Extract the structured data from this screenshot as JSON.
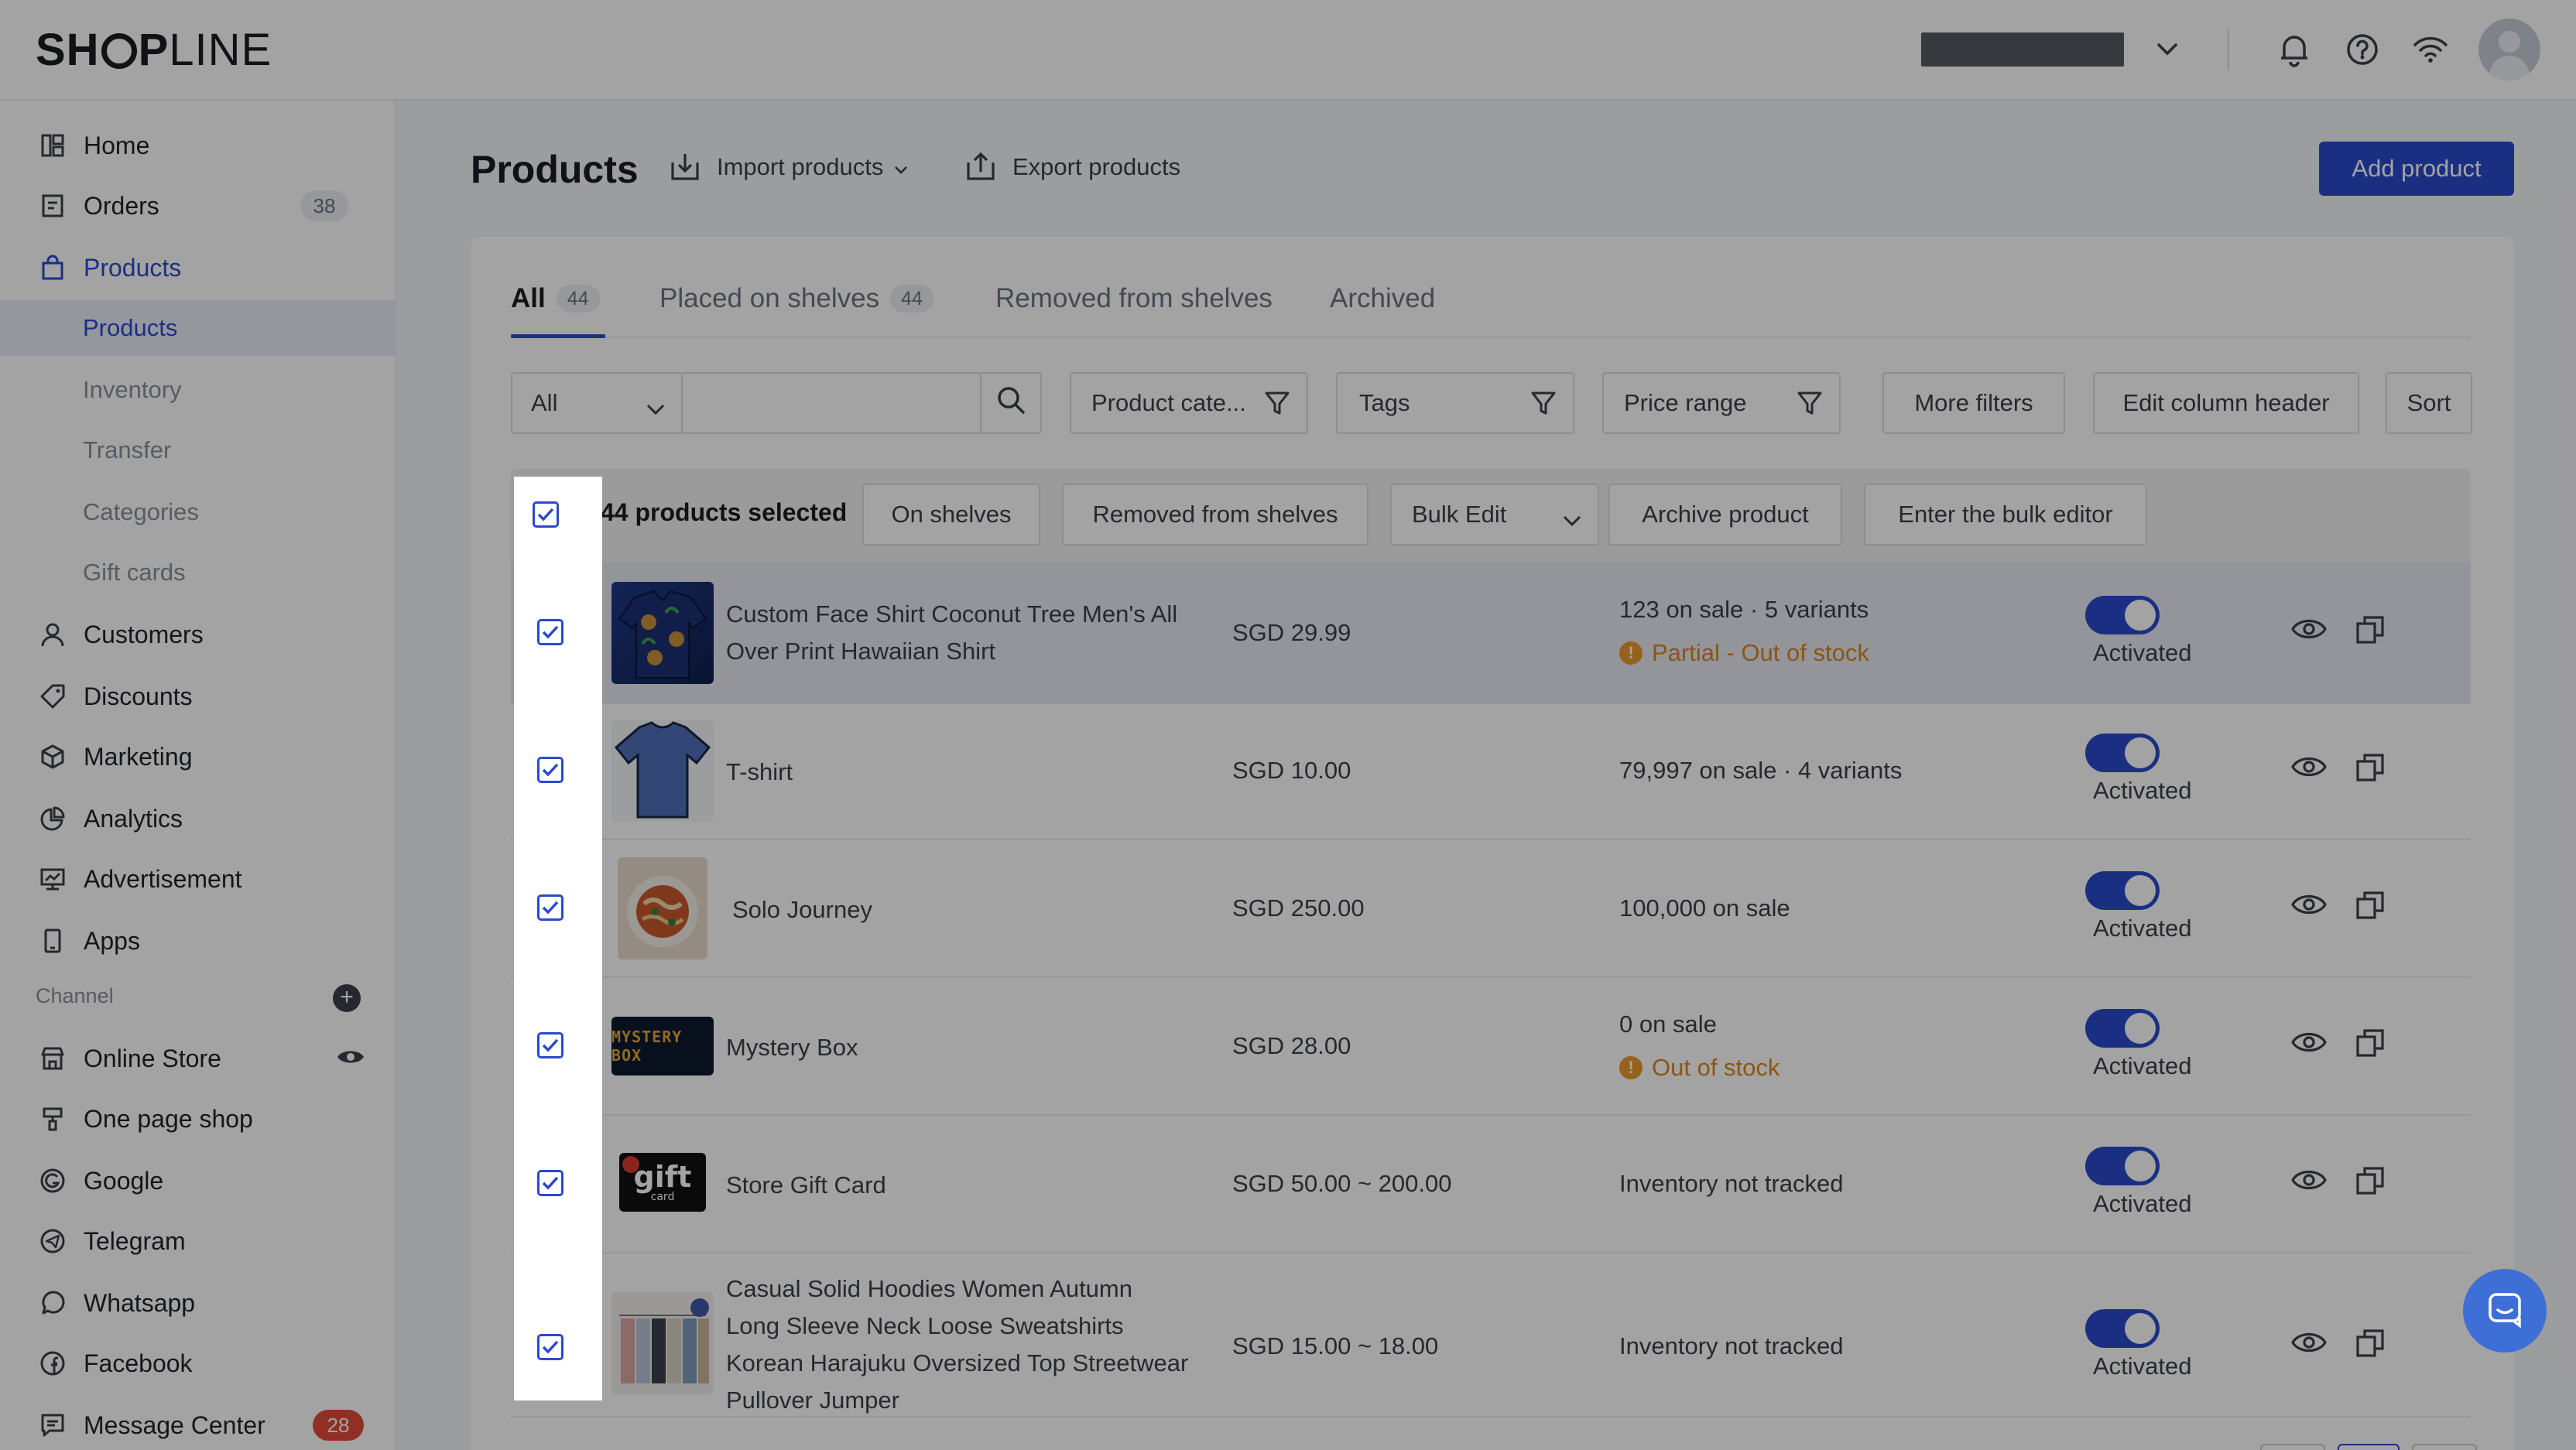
{
  "brand": {
    "logo_left": "SH",
    "logo_right_bold": "P",
    "logo_right_thin": "LINE",
    "accent": "#2b4acb"
  },
  "sidebar": {
    "home": "Home",
    "orders": "Orders",
    "orders_count": "38",
    "products": "Products",
    "sub": {
      "products": "Products",
      "inventory": "Inventory",
      "transfer": "Transfer",
      "categories": "Categories",
      "gift_cards": "Gift cards"
    },
    "customers": "Customers",
    "discounts": "Discounts",
    "marketing": "Marketing",
    "analytics": "Analytics",
    "advertisement": "Advertisement",
    "apps": "Apps",
    "channel_label": "Channel",
    "online_store": "Online Store",
    "one_page_shop": "One page shop",
    "google": "Google",
    "telegram": "Telegram",
    "whatsapp": "Whatsapp",
    "facebook": "Facebook",
    "message_center": "Message Center",
    "message_count": "28"
  },
  "header": {
    "title": "Products",
    "import": "Import products",
    "export": "Export products",
    "add": "Add product"
  },
  "tabs": {
    "all": "All",
    "all_count": "44",
    "on_shelves": "Placed on shelves",
    "on_shelves_count": "44",
    "removed": "Removed from shelves",
    "archived": "Archived"
  },
  "filters": {
    "scope": "All",
    "category": "Product cate...",
    "tags": "Tags",
    "price": "Price range",
    "more": "More filters",
    "edit_columns": "Edit column header",
    "sort": "Sort"
  },
  "bulk": {
    "selected": "44 products selected",
    "on_shelves": "On shelves",
    "removed": "Removed from shelves",
    "bulk_edit": "Bulk Edit",
    "archive": "Archive product",
    "bulk_editor": "Enter the bulk editor"
  },
  "rows": [
    {
      "name": "Custom Face Shirt Coconut Tree Men's All Over Print Hawaiian Shirt",
      "price": "SGD 29.99",
      "stock": "123 on sale · 5 variants",
      "warning": "Partial - Out of stock",
      "status": "Activated"
    },
    {
      "name": "T-shirt",
      "price": "SGD 10.00",
      "stock": "79,997 on sale · 4 variants",
      "warning": "",
      "status": "Activated"
    },
    {
      "name": "Solo Journey",
      "price": "SGD 250.00",
      "stock": "100,000 on sale",
      "warning": "",
      "status": "Activated"
    },
    {
      "name": "Mystery Box",
      "price": "SGD 28.00",
      "stock": "0 on sale",
      "warning": "Out of stock",
      "status": "Activated",
      "thumb_text": "MYSTERY BOX"
    },
    {
      "name": "Store Gift Card",
      "price": "SGD 50.00 ~  200.00",
      "stock": "Inventory not tracked",
      "warning": "",
      "status": "Activated",
      "thumb_text": "gift",
      "thumb_sub": "card"
    },
    {
      "name": "Casual Solid Hoodies Women Autumn Long Sleeve Neck Loose Sweatshirts Korean Harajuku Oversized Top Streetwear Pullover Jumper",
      "price": "SGD 15.00 ~  18.00",
      "stock": "Inventory not tracked",
      "warning": "",
      "status": "Activated"
    }
  ]
}
